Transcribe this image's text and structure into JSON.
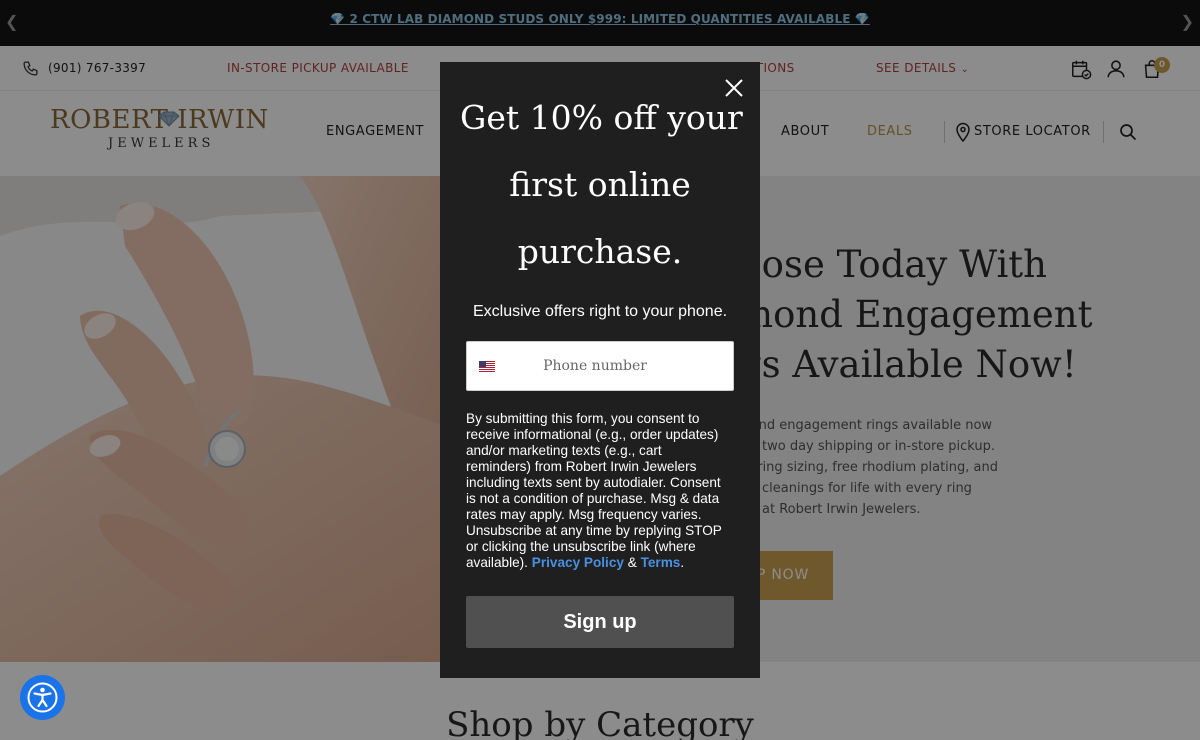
{
  "promo": {
    "text": "💎 2 CTW LAB DIAMOND STUDS ONLY $999: LIMITED QUANTITIES AVAILABLE 💎"
  },
  "infobar": {
    "phone": "(901) 767-3397",
    "pickup": "IN-STORE PICKUP AVAILABLE",
    "purchase_options": "HASE OPTIONS",
    "see_details": "SEE DETAILS",
    "cart_count": "0"
  },
  "logo": {
    "top": "ROBERT  IRWIN",
    "bottom": "JEWELERS"
  },
  "nav": {
    "engagement": "ENGAGEMENT",
    "about": "ABOUT",
    "deals": "DEALS",
    "store_locator": "STORE LOCATOR"
  },
  "hero": {
    "title_lines": [
      "pose Today With",
      "mond Engagement",
      "gs Available Now!"
    ],
    "desc_lines": [
      "mond engagement rings available now",
      " two day shipping or in-store pickup.",
      "e ring sizing, free rhodium plating, and",
      "cleanings for life with every ring",
      " at Robert Irwin Jewelers."
    ],
    "button": "P NOW"
  },
  "shop_category": "Shop by Category",
  "modal": {
    "heading_lines": [
      "Get 10% off your",
      "first online",
      "purchase."
    ],
    "subtitle": "Exclusive offers right to your phone.",
    "phone_placeholder": "Phone number",
    "consent_lines": [
      "By submitting this form, you consent to",
      "receive informational (e.g., order updates)",
      "and/or marketing texts (e.g., cart",
      "reminders) from Robert Irwin Jewelers",
      "including texts sent by autodialer. Consent",
      "is not a condition of purchase. Msg & data",
      "rates may apply. Msg frequency varies.",
      "Unsubscribe at any time by replying STOP",
      "or clicking the unsubscribe link (where",
      "available)."
    ],
    "privacy_link": "Privacy Policy",
    "amp": " & ",
    "terms_link": "Terms",
    "period": ".",
    "signup_label": "Sign up"
  },
  "colors": {
    "modal_bg": "#1f1f1f",
    "link_blue": "#4a90e2",
    "gold": "#caa150",
    "promo_text": "#8fc6e8",
    "accent_red": "#b0413e"
  },
  "icons": [
    "chevron-left-icon",
    "chevron-right-icon",
    "phone-icon",
    "chevron-down-icon",
    "calendar-check-icon",
    "user-icon",
    "shopping-bag-icon",
    "diamond-icon",
    "map-pin-icon",
    "search-icon",
    "close-icon",
    "us-flag-icon",
    "accessibility-icon"
  ]
}
